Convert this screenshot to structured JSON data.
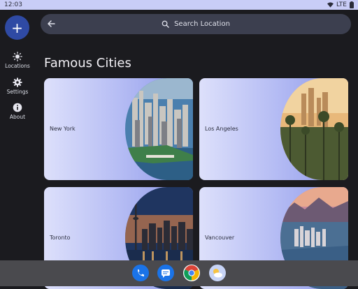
{
  "status_bar": {
    "time": "12:03",
    "network": "LTE"
  },
  "rail": {
    "fab_icon": "add-icon",
    "fab_label": "+",
    "items": [
      {
        "label": "Locations",
        "icon": "sun-icon"
      },
      {
        "label": "Settings",
        "icon": "gear-icon"
      },
      {
        "label": "About",
        "icon": "info-icon"
      }
    ]
  },
  "search": {
    "placeholder": "Search Location",
    "back_icon": "arrow-back-icon",
    "search_icon": "search-icon"
  },
  "section_title": "Famous Cities",
  "cities": [
    {
      "name": "New York"
    },
    {
      "name": "Los Angeles"
    },
    {
      "name": "Toronto"
    },
    {
      "name": "Vancouver"
    }
  ],
  "dock": {
    "apps": [
      {
        "name": "phone-icon",
        "color": "#1a73e8"
      },
      {
        "name": "messages-icon",
        "color": "#1a73e8"
      },
      {
        "name": "chrome-icon",
        "color": "#db4437"
      },
      {
        "name": "weather-icon",
        "color": "#c7d4f7"
      }
    ]
  },
  "colors": {
    "accent": "#2f4aa4",
    "card_gradient_start": "#dde0fb",
    "card_gradient_end": "#8c97ea"
  }
}
